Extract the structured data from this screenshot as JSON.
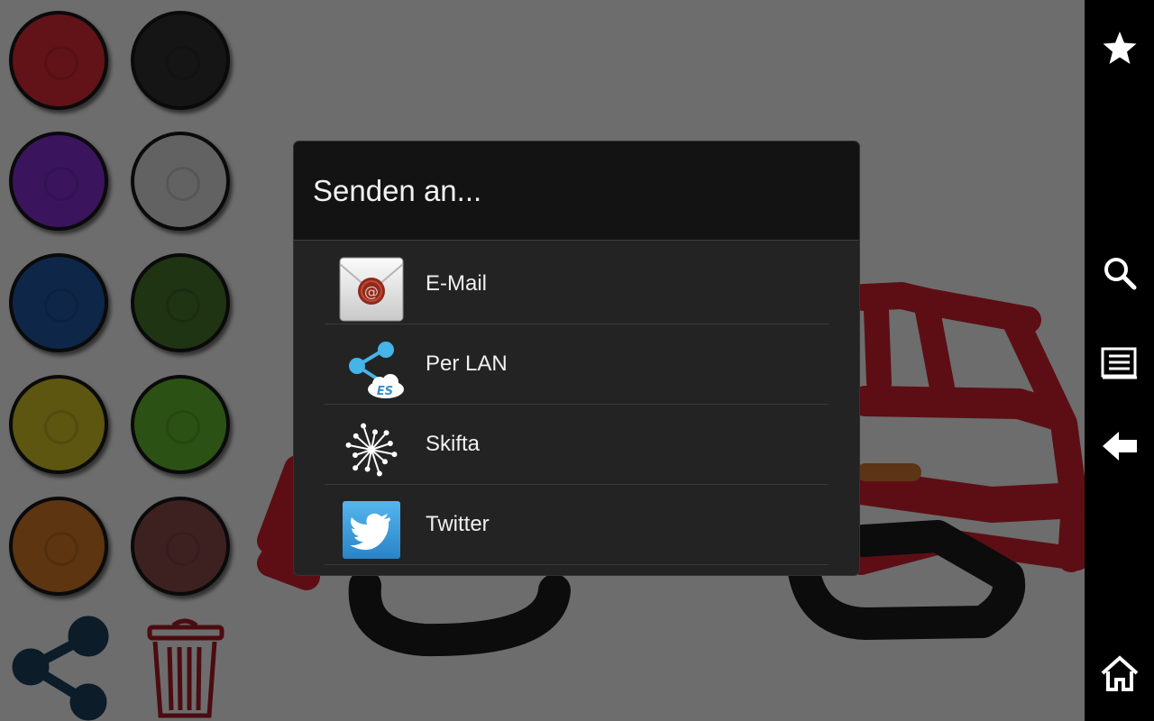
{
  "palette": {
    "swatches": [
      {
        "name": "red",
        "color": "#611318"
      },
      {
        "name": "black",
        "color": "#151515"
      },
      {
        "name": "purple",
        "color": "#3a155e"
      },
      {
        "name": "gray",
        "color": "#626262"
      },
      {
        "name": "blue",
        "color": "#0e2648"
      },
      {
        "name": "dark-green",
        "color": "#1f3413"
      },
      {
        "name": "yellow",
        "color": "#5c5610"
      },
      {
        "name": "green",
        "color": "#2b5214"
      },
      {
        "name": "orange",
        "color": "#5d3510"
      },
      {
        "name": "brown",
        "color": "#3d2121"
      }
    ],
    "share_icon": "share-icon",
    "trash_icon": "trash-icon"
  },
  "dialog": {
    "title": "Senden an...",
    "items": [
      {
        "label": "E-Mail",
        "icon": "email-icon"
      },
      {
        "label": "Per LAN",
        "icon": "es-lan-share-icon"
      },
      {
        "label": "Skifta",
        "icon": "skifta-icon"
      },
      {
        "label": "Twitter",
        "icon": "twitter-icon"
      }
    ]
  },
  "sidebar": {
    "buttons": [
      "star-icon",
      "search-icon",
      "menu-icon",
      "back-icon",
      "home-icon"
    ]
  },
  "colors": {
    "overlay_background": "#6d6d6d",
    "dialog_header": "#131313",
    "dialog_body": "#232323",
    "sidebar": "#000000",
    "drawing_red": "#5d0e14",
    "drawing_black": "#0c0c0c"
  }
}
